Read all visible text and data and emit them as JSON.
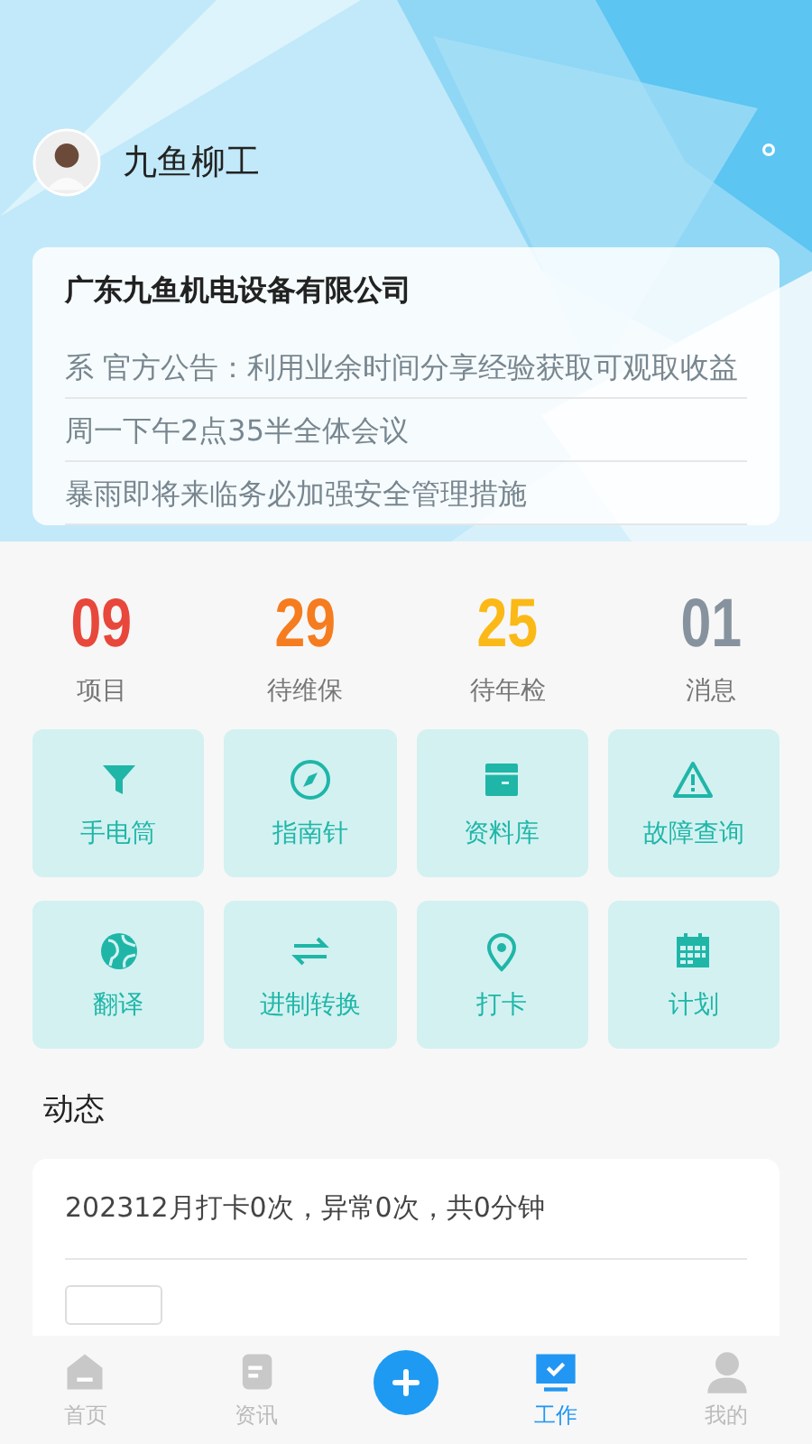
{
  "user": {
    "name": "九鱼柳工"
  },
  "notice": {
    "company": "广东九鱼机电设备有限公司",
    "items": [
      "系 官方公告：利用业余时间分享经验获取可观取收益",
      "周一下午2点35半全体会议",
      "暴雨即将来临务必加强安全管理措施"
    ]
  },
  "stats": [
    {
      "value": "09",
      "label": "项目",
      "color": "#e8473b"
    },
    {
      "value": "29",
      "label": "待维保",
      "color": "#f57c1f"
    },
    {
      "value": "25",
      "label": "待年检",
      "color": "#fbb917"
    },
    {
      "value": "01",
      "label": "消息",
      "color": "#86939e"
    }
  ],
  "tools": [
    {
      "kind": "filter",
      "label": "手电筒"
    },
    {
      "kind": "compass",
      "label": "指南针"
    },
    {
      "kind": "box",
      "label": "资料库"
    },
    {
      "kind": "warning",
      "label": "故障查询"
    },
    {
      "kind": "globe",
      "label": "翻译"
    },
    {
      "kind": "swap",
      "label": "进制转换"
    },
    {
      "kind": "pin",
      "label": "打卡"
    },
    {
      "kind": "calendar",
      "label": "计划"
    }
  ],
  "feed": {
    "title": "动态",
    "summary": "202312月打卡0次，异常0次，共0分钟"
  },
  "tabbar": [
    {
      "kind": "home",
      "label": "首页",
      "selected": false
    },
    {
      "kind": "news",
      "label": "资讯",
      "selected": false
    },
    {
      "kind": "add"
    },
    {
      "kind": "work",
      "label": "工作",
      "selected": true
    },
    {
      "kind": "me",
      "label": "我的",
      "selected": false
    }
  ]
}
